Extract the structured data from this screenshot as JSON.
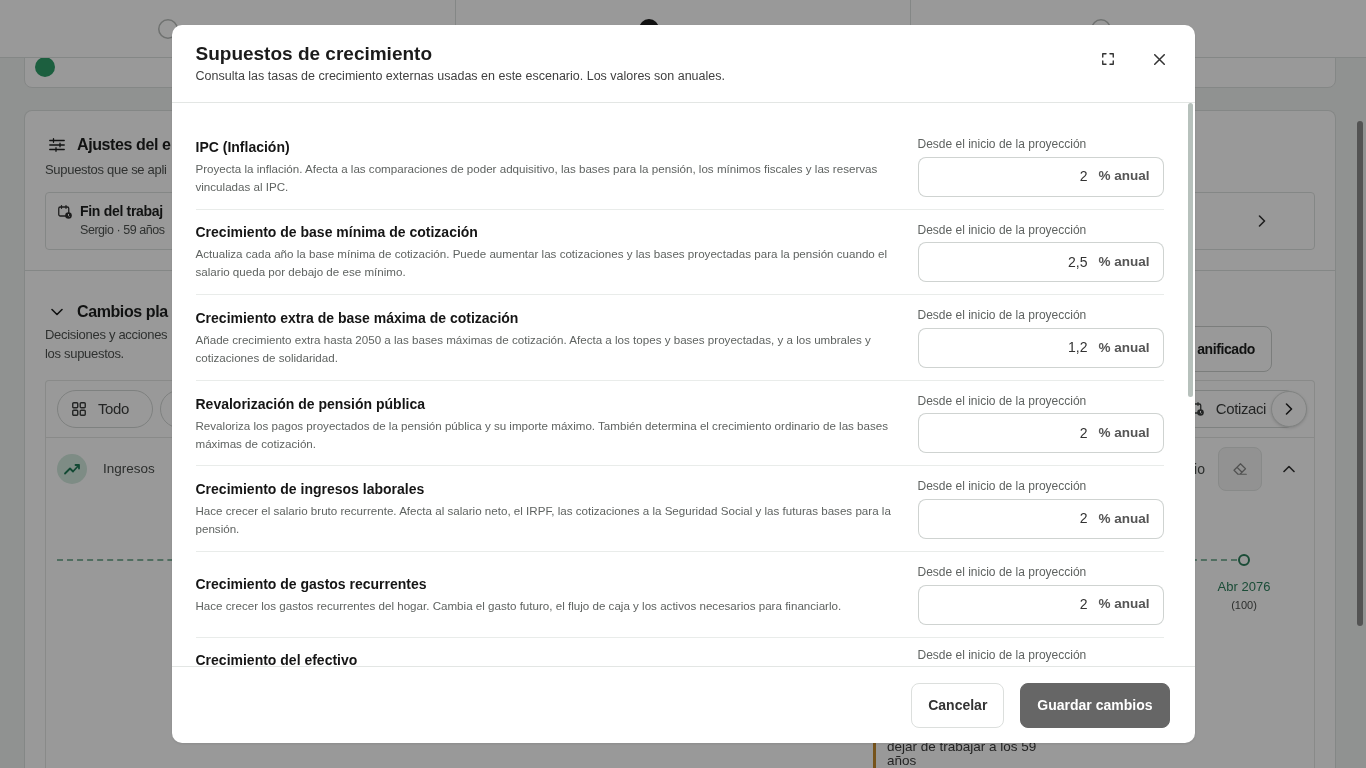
{
  "page": {
    "steps": [
      {
        "selected": false
      },
      {
        "selected": true
      },
      {
        "selected": false
      }
    ],
    "settings": {
      "title": "Ajustes del e",
      "subtitle": "Supuestos que se apli",
      "item": {
        "title": "Fin del trabaj",
        "subtitle": "Sergio · 59 años"
      }
    },
    "changes": {
      "title": "Cambios pla",
      "expanded": true,
      "description_lines": [
        "Decisiones y acciones",
        "los supuestos."
      ],
      "add_button": "anificado",
      "filters": [
        {
          "kind": "all",
          "label": "Todo"
        },
        {
          "kind": "category",
          "label": "Cotizaci"
        }
      ],
      "group": {
        "label": "Ingresos",
        "expanded": true,
        "trailing_text": "io"
      },
      "timeline_end": {
        "date": "Abr 2076",
        "age": "(100)"
      },
      "note_lines": [
        "dejar de trabajar a los 59",
        "años"
      ]
    }
  },
  "dialog": {
    "title": "Supuestos de crecimiento",
    "subtitle": "Consulta las tasas de crecimiento externas usadas en este escenario. Los valores son anuales.",
    "assumptions": [
      {
        "name": "IPC (Inflación)",
        "description": "Proyecta la inflación. Afecta a las comparaciones de poder adquisitivo, las bases para la pensión, los mínimos fiscales y las reservas vinculadas al IPC.",
        "field_label": "Desde el inicio de la proyección",
        "value": "2",
        "unit": "% anual"
      },
      {
        "name": "Crecimiento de base mínima de cotización",
        "description": "Actualiza cada año la base mínima de cotización. Puede aumentar las cotizaciones y las bases proyectadas para la pensión cuando el salario queda por debajo de ese mínimo.",
        "field_label": "Desde el inicio de la proyección",
        "value": "2,5",
        "unit": "% anual"
      },
      {
        "name": "Crecimiento extra de base máxima de cotización",
        "description": "Añade crecimiento extra hasta 2050 a las bases máximas de cotización. Afecta a los topes y bases proyectadas, y a los umbrales y cotizaciones de solidaridad.",
        "field_label": "Desde el inicio de la proyección",
        "value": "1,2",
        "unit": "% anual"
      },
      {
        "name": "Revalorización de pensión pública",
        "description": "Revaloriza los pagos proyectados de la pensión pública y su importe máximo. También determina el crecimiento ordinario de las bases máximas de cotización.",
        "field_label": "Desde el inicio de la proyección",
        "value": "2",
        "unit": "% anual"
      },
      {
        "name": "Crecimiento de ingresos laborales",
        "description": "Hace crecer el salario bruto recurrente. Afecta al salario neto, el IRPF, las cotizaciones a la Seguridad Social y las futuras bases para la pensión.",
        "field_label": "Desde el inicio de la proyección",
        "value": "2",
        "unit": "% anual"
      },
      {
        "name": "Crecimiento de gastos recurrentes",
        "description": "Hace crecer los gastos recurrentes del hogar. Cambia el gasto futuro, el flujo de caja y los activos necesarios para financiarlo.",
        "field_label": "Desde el inicio de la proyección",
        "value": "2",
        "unit": "% anual"
      },
      {
        "name": "Crecimiento del efectivo",
        "field_label": "Desde el inicio de la proyección"
      }
    ],
    "buttons": [
      {
        "label": "Cancelar",
        "kind": "secondary"
      },
      {
        "label": "Guardar cambios",
        "kind": "primary"
      }
    ]
  }
}
